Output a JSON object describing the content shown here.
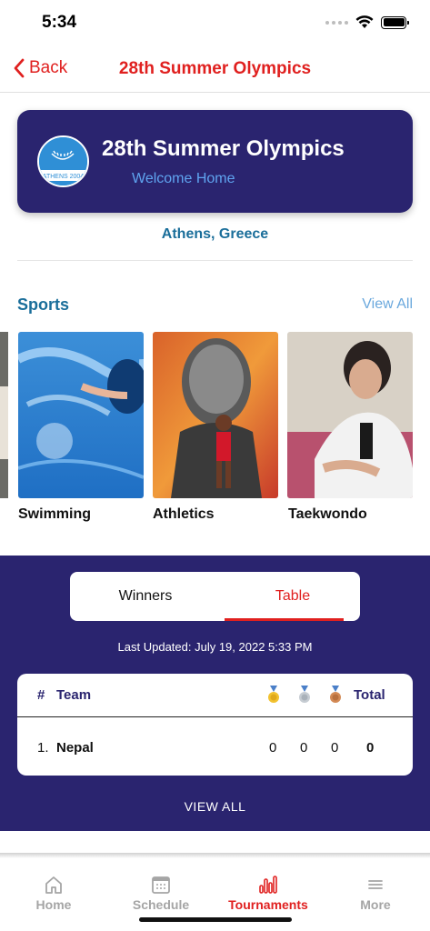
{
  "status_bar": {
    "time": "5:34"
  },
  "nav": {
    "back_label": "Back",
    "title": "28th Summer Olympics"
  },
  "hero": {
    "title": "28th Summer Olympics",
    "subtitle": "Welcome Home",
    "logo_text": "ATHENS 2004"
  },
  "location": "Athens, Greece",
  "sports": {
    "title": "Sports",
    "view_all": "View All",
    "items": [
      {
        "label": "Swimming"
      },
      {
        "label": "Athletics"
      },
      {
        "label": "Taekwondo"
      }
    ]
  },
  "medals": {
    "tabs": [
      {
        "label": "Winners"
      },
      {
        "label": "Table"
      }
    ],
    "active_tab": "Table",
    "last_updated": "Last Updated: July 19, 2022 5:33 PM",
    "headers": {
      "rank": "#",
      "team": "Team",
      "total": "Total"
    },
    "rows": [
      {
        "rank": "1.",
        "team": "Nepal",
        "gold": "0",
        "silver": "0",
        "bronze": "0",
        "total": "0"
      }
    ],
    "view_all": "VIEW ALL"
  },
  "tab_bar": {
    "items": [
      {
        "label": "Home",
        "icon": "home-icon"
      },
      {
        "label": "Schedule",
        "icon": "calendar-icon"
      },
      {
        "label": "Tournaments",
        "icon": "bar-chart-icon"
      },
      {
        "label": "More",
        "icon": "menu-icon"
      }
    ],
    "active": "Tournaments"
  },
  "colors": {
    "accent": "#e0201f",
    "navy": "#2a246f",
    "link": "#1a6e9a"
  }
}
